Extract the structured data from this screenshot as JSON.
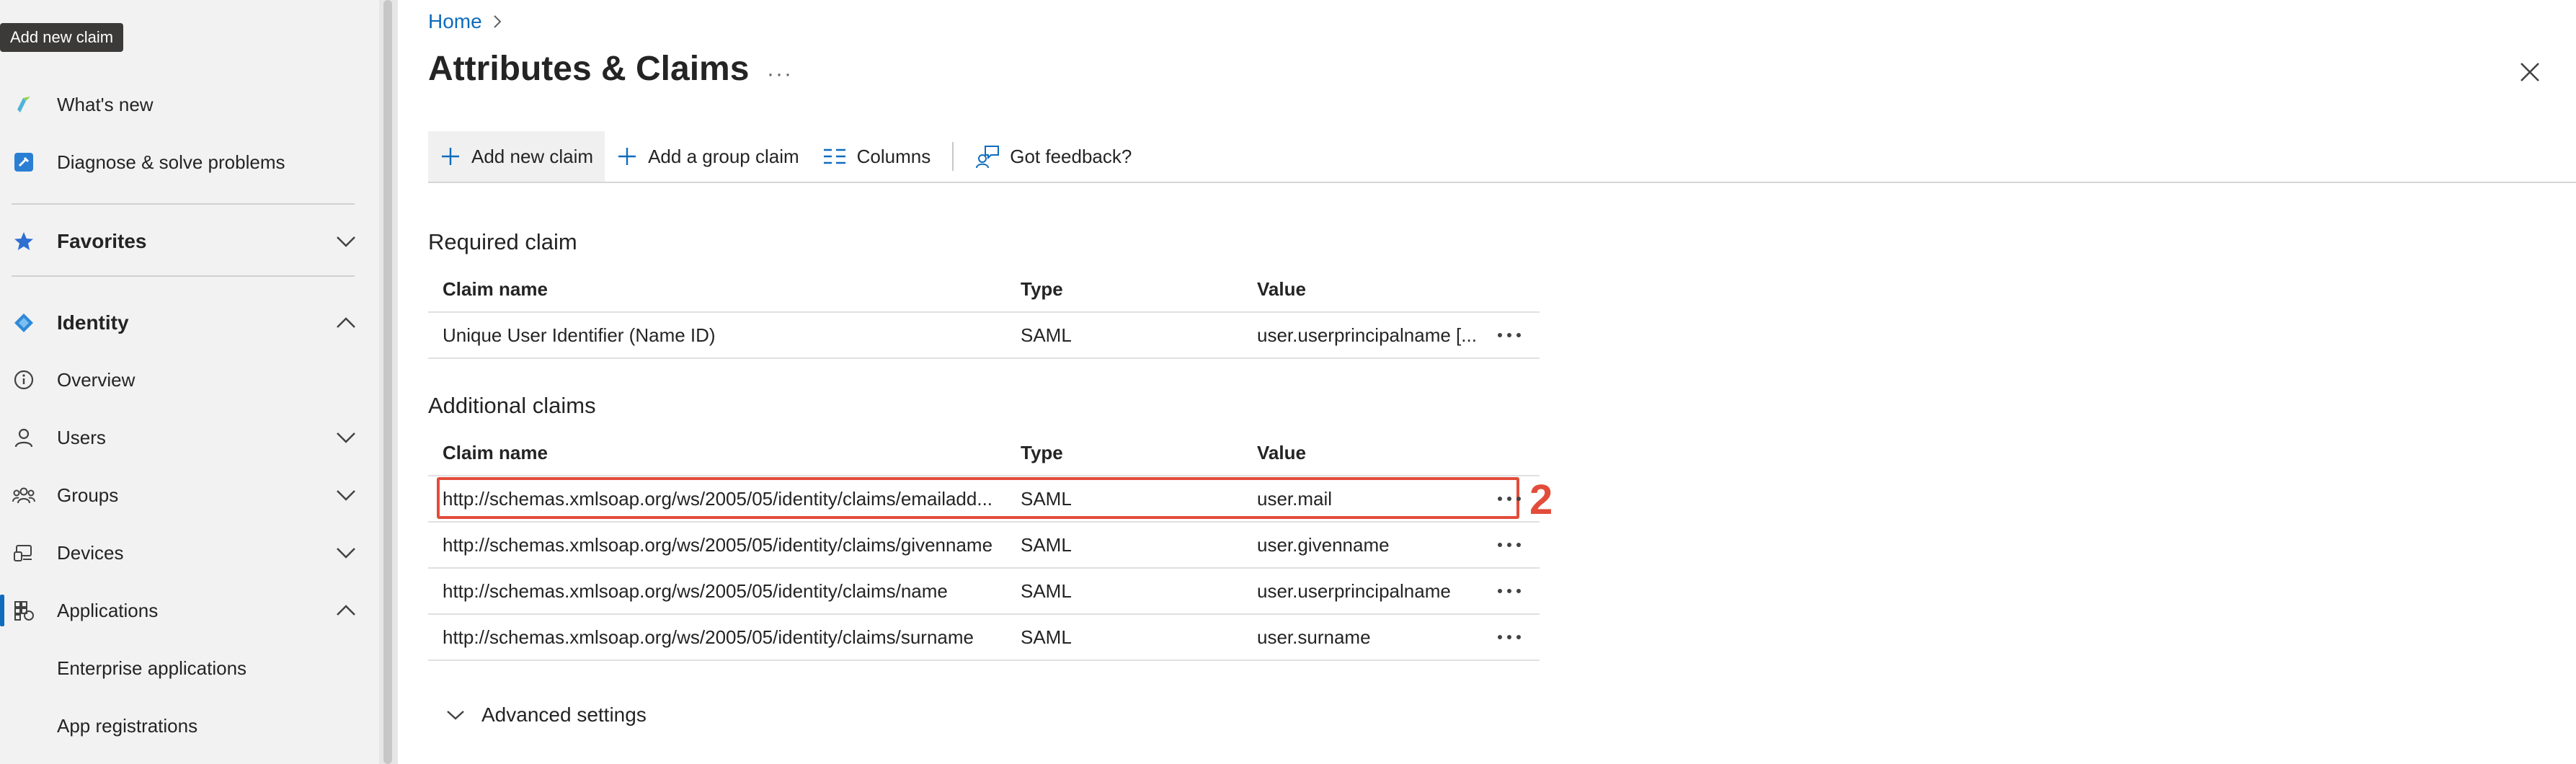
{
  "tooltip": "Add new claim",
  "sidebar": {
    "items": [
      {
        "label": "What's new"
      },
      {
        "label": "Diagnose & solve problems"
      },
      {
        "label": "Favorites"
      },
      {
        "label": "Identity"
      },
      {
        "label": "Overview"
      },
      {
        "label": "Users"
      },
      {
        "label": "Groups"
      },
      {
        "label": "Devices"
      },
      {
        "label": "Applications"
      },
      {
        "label": "Enterprise applications"
      },
      {
        "label": "App registrations"
      }
    ]
  },
  "breadcrumb": {
    "home": "Home",
    "separator": ">"
  },
  "page": {
    "title": "Attributes & Claims",
    "more": "···"
  },
  "toolbar": {
    "add_new_claim": "Add new claim",
    "add_group_claim": "Add a group claim",
    "columns": "Columns",
    "feedback": "Got feedback?"
  },
  "required": {
    "title": "Required claim",
    "headers": {
      "name": "Claim name",
      "type": "Type",
      "value": "Value"
    },
    "rows": [
      {
        "name": "Unique User Identifier (Name ID)",
        "type": "SAML",
        "value": "user.userprincipalname [..."
      }
    ]
  },
  "additional": {
    "title": "Additional claims",
    "headers": {
      "name": "Claim name",
      "type": "Type",
      "value": "Value"
    },
    "rows": [
      {
        "name": "http://schemas.xmlsoap.org/ws/2005/05/identity/claims/emailadd...",
        "type": "SAML",
        "value": "user.mail"
      },
      {
        "name": "http://schemas.xmlsoap.org/ws/2005/05/identity/claims/givenname",
        "type": "SAML",
        "value": "user.givenname"
      },
      {
        "name": "http://schemas.xmlsoap.org/ws/2005/05/identity/claims/name",
        "type": "SAML",
        "value": "user.userprincipalname"
      },
      {
        "name": "http://schemas.xmlsoap.org/ws/2005/05/identity/claims/surname",
        "type": "SAML",
        "value": "user.surname"
      }
    ]
  },
  "annotation": {
    "step": "2"
  },
  "advanced": {
    "label": "Advanced settings"
  },
  "colors": {
    "accent": "#0f6cbd",
    "highlight": "#e24c3a"
  }
}
